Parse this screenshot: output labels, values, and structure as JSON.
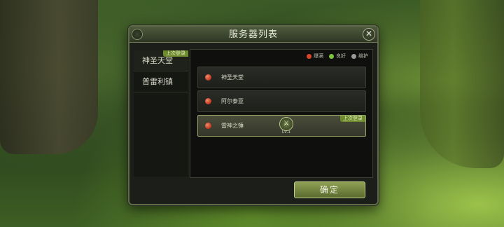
{
  "dialog": {
    "title": "服务器列表",
    "close_glyph": "✕",
    "confirm_label": "确定"
  },
  "legend": {
    "full": "爆满",
    "good": "良好",
    "maintenance": "维护",
    "colors": {
      "full": "#d9442a",
      "good": "#7ec43a",
      "maintenance": "#9a9a9a"
    }
  },
  "realms": [
    {
      "name": "神圣天堂",
      "tag": "上次登录",
      "active": true
    },
    {
      "name": "普雷利镇",
      "tag": "",
      "active": false
    }
  ],
  "servers": [
    {
      "name": "神圣天堂",
      "status": "full"
    },
    {
      "name": "阿尔泰亚",
      "status": "full"
    },
    {
      "name": "雷神之锤",
      "status": "full",
      "selected": true,
      "tag": "上次登录",
      "character_icon": "crossed-swords-icon",
      "character_level": "Lv.1"
    }
  ]
}
